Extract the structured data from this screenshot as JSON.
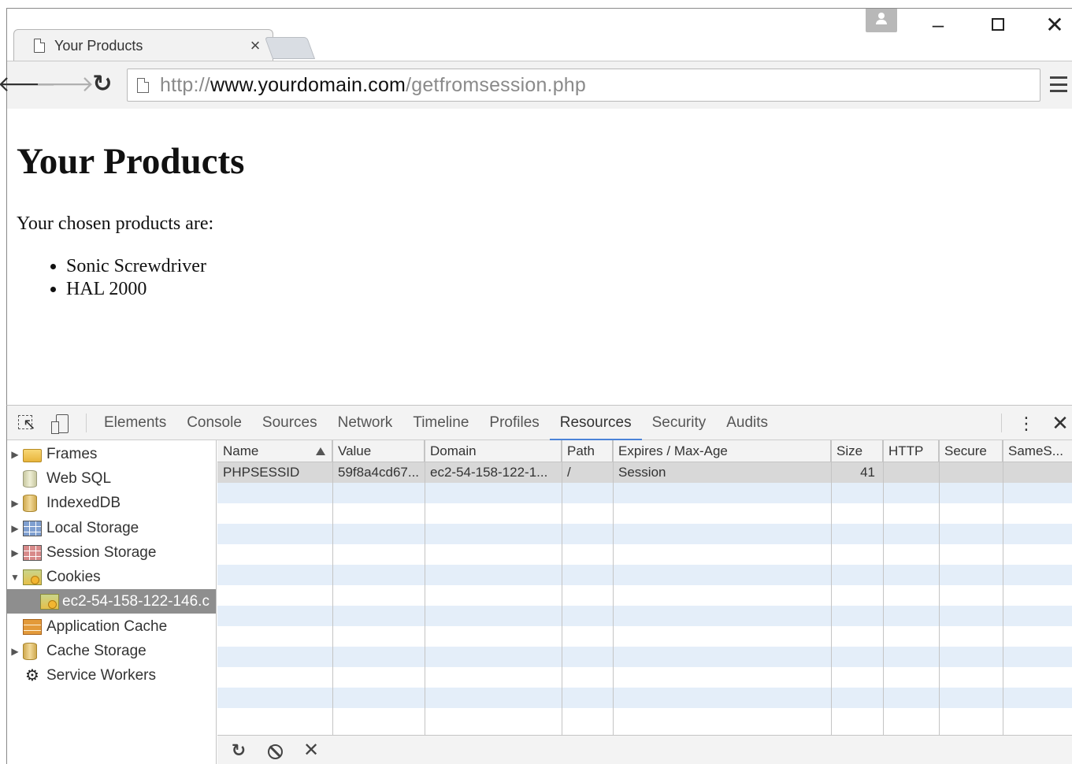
{
  "browser": {
    "tab_title": "Your Products",
    "tab_close_glyph": "×",
    "url_scheme": "http://",
    "url_host": "www.yourdomain.com",
    "url_path": "/getfromsession.php"
  },
  "page": {
    "heading": "Your Products",
    "intro": "Your chosen products are:",
    "products": [
      "Sonic Screwdriver",
      "HAL 2000"
    ]
  },
  "devtools": {
    "tabs": [
      "Elements",
      "Console",
      "Sources",
      "Network",
      "Timeline",
      "Profiles",
      "Resources",
      "Security",
      "Audits"
    ],
    "active_tab": "Resources",
    "sidebar": [
      {
        "label": "Frames",
        "icon": "folder-icon",
        "expandable": true,
        "expanded": false
      },
      {
        "label": "Web SQL",
        "icon": "database-icon",
        "expandable": false
      },
      {
        "label": "IndexedDB",
        "icon": "database-icon",
        "expandable": true,
        "expanded": false
      },
      {
        "label": "Local Storage",
        "icon": "storage-grid-icon",
        "expandable": true,
        "expanded": false
      },
      {
        "label": "Session Storage",
        "icon": "storage-grid-icon",
        "expandable": true,
        "expanded": false
      },
      {
        "label": "Cookies",
        "icon": "cookie-icon",
        "expandable": true,
        "expanded": true
      },
      {
        "label": "ec2-54-158-122-146.c",
        "icon": "cookie-icon",
        "selected": true
      },
      {
        "label": "Application Cache",
        "icon": "app-cache-icon",
        "expandable": false
      },
      {
        "label": "Cache Storage",
        "icon": "database-icon",
        "expandable": true,
        "expanded": false
      },
      {
        "label": "Service Workers",
        "icon": "gear-icon",
        "expandable": false
      }
    ],
    "cookie_table": {
      "columns": [
        "Name",
        "Value",
        "Domain",
        "Path",
        "Expires / Max-Age",
        "Size",
        "HTTP",
        "Secure",
        "SameS..."
      ],
      "sorted_column": "Name",
      "rows": [
        {
          "name": "PHPSESSID",
          "value": "59f8a4cd67...",
          "domain": "ec2-54-158-122-1...",
          "path": "/",
          "expires": "Session",
          "size": "41",
          "http": "",
          "secure": "",
          "samesite": ""
        }
      ]
    }
  }
}
